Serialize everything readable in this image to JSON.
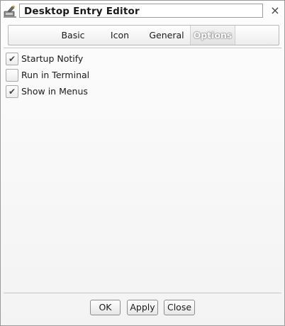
{
  "window": {
    "title": "Desktop Entry Editor",
    "app_icon": "desktop-entry-editor-icon",
    "close_glyph": "×"
  },
  "tabs": [
    {
      "label": "Basic",
      "active": false
    },
    {
      "label": "Icon",
      "active": false
    },
    {
      "label": "General",
      "active": false
    },
    {
      "label": "Options",
      "active": true
    }
  ],
  "options": [
    {
      "label": "Startup Notify",
      "checked": true,
      "mark": "✔"
    },
    {
      "label": "Run in Terminal",
      "checked": false,
      "mark": ""
    },
    {
      "label": "Show in Menus",
      "checked": true,
      "mark": "✔"
    }
  ],
  "buttons": {
    "ok": "OK",
    "apply": "Apply",
    "close": "Close"
  }
}
